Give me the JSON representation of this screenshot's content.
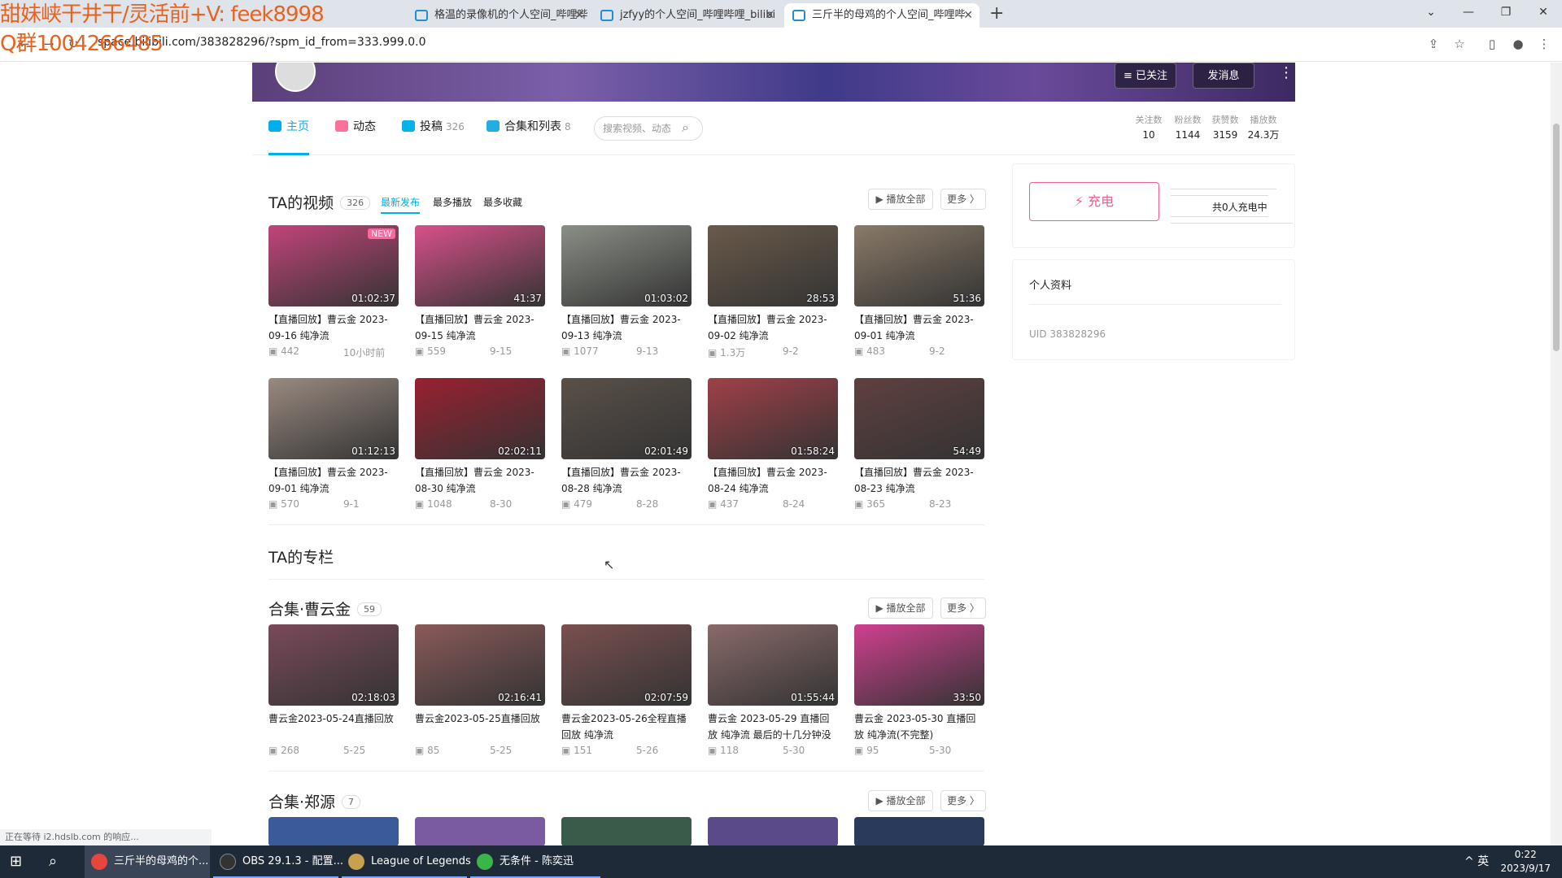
{
  "watermark": {
    "line1": "甜妹峡干井干/灵活前+V: feek8998",
    "line2": "Q群1004266485"
  },
  "browser": {
    "tabs": [
      {
        "label": "格温的录像机的个人空间_哔哩哔"
      },
      {
        "label": "jzfyy的个人空间_哔哩哔哩_bilibi"
      },
      {
        "label": "三斤半的母鸡的个人空间_哔哩哔"
      }
    ],
    "new_tab": "+",
    "url": "space.bilibili.com/383828296/?spm_id_from=333.999.0.0"
  },
  "banner": {
    "follow_label": "≡ 已关注",
    "message_label": "发消息",
    "more": "⋮"
  },
  "nav": {
    "items": [
      {
        "label": "主页",
        "count": "",
        "color": "#00aeec"
      },
      {
        "label": "动态",
        "count": "",
        "color": "#fb7299"
      },
      {
        "label": "投稿",
        "count": "326",
        "color": "#00b5e5"
      },
      {
        "label": "合集和列表",
        "count": "8",
        "color": "#23ade5"
      }
    ],
    "search_placeholder": "搜索视频、动态",
    "stats": [
      {
        "label": "关注数",
        "value": "10"
      },
      {
        "label": "粉丝数",
        "value": "1144"
      },
      {
        "label": "获赞数",
        "value": "3159"
      },
      {
        "label": "播放数",
        "value": "24.3万"
      }
    ]
  },
  "videos": {
    "title": "TA的视频",
    "count": "326",
    "sorts": [
      "最新发布",
      "最多播放",
      "最多收藏"
    ],
    "play_all": "▶ 播放全部",
    "more": "更多 〉",
    "items": [
      {
        "title": "【直播回放】曹云金 2023-09-16 纯净流",
        "duration": "01:02:37",
        "plays": "442",
        "date": "10小时前",
        "new": "NEW",
        "color": "#c2447a"
      },
      {
        "title": "【直播回放】曹云金 2023-09-15 纯净流",
        "duration": "41:37",
        "plays": "559",
        "date": "9-15",
        "color": "#d8508a"
      },
      {
        "title": "【直播回放】曹云金 2023-09-13 纯净流",
        "duration": "01:03:02",
        "plays": "1077",
        "date": "9-13",
        "color": "#8a8f86"
      },
      {
        "title": "【直播回放】曹云金 2023-09-02 纯净流",
        "duration": "28:53",
        "plays": "1.3万",
        "date": "9-2",
        "color": "#6a5a4a"
      },
      {
        "title": "【直播回放】曹云金 2023-09-01 纯净流",
        "duration": "51:36",
        "plays": "483",
        "date": "9-2",
        "color": "#8a7a68"
      },
      {
        "title": "【直播回放】曹云金 2023-09-01 纯净流",
        "duration": "01:12:13",
        "plays": "570",
        "date": "9-1",
        "color": "#9a8a80"
      },
      {
        "title": "【直播回放】曹云金 2023-08-30 纯净流",
        "duration": "02:02:11",
        "plays": "1048",
        "date": "8-30",
        "color": "#9a2030"
      },
      {
        "title": "【直播回放】曹云金 2023-08-28 纯净流",
        "duration": "02:01:49",
        "plays": "479",
        "date": "8-28",
        "color": "#5a5048"
      },
      {
        "title": "【直播回放】曹云金 2023-08-24 纯净流",
        "duration": "01:58:24",
        "plays": "437",
        "date": "8-24",
        "color": "#a04048"
      },
      {
        "title": "【直播回放】曹云金 2023-08-23 纯净流",
        "duration": "54:49",
        "plays": "365",
        "date": "8-23",
        "color": "#604040"
      }
    ]
  },
  "column": {
    "title": "TA的专栏"
  },
  "collection1": {
    "title": "合集·曹云金",
    "count": "59",
    "play_all": "▶ 播放全部",
    "more": "更多 〉",
    "items": [
      {
        "title": "曹云金2023-05-24直播回放",
        "duration": "02:18:03",
        "plays": "268",
        "date": "5-25",
        "color": "#7a4a5a"
      },
      {
        "title": "曹云金2023-05-25直播回放",
        "duration": "02:16:41",
        "plays": "85",
        "date": "5-25",
        "color": "#8a5a5a"
      },
      {
        "title": "曹云金2023-05-26全程直播回放 纯净流",
        "duration": "02:07:59",
        "plays": "151",
        "date": "5-26",
        "color": "#7a5050"
      },
      {
        "title": "曹云金 2023-05-29 直播回放 纯净流 最后的十几分钟没录好",
        "duration": "01:55:44",
        "plays": "118",
        "date": "5-30",
        "color": "#8a6a6a"
      },
      {
        "title": "曹云金 2023-05-30 直播回放 纯净流(不完整)",
        "duration": "33:50",
        "plays": "95",
        "date": "5-30",
        "color": "#d04090"
      }
    ]
  },
  "collection2": {
    "title": "合集·郑源",
    "count": "7",
    "play_all": "▶ 播放全部",
    "more": "更多 〉"
  },
  "sidebar": {
    "charge_label": "⚡ 充电",
    "charge_count": "共0人充电中",
    "profile_label": "个人资料",
    "uid": "UID  383828296"
  },
  "status_text": "正在等待 i2.hdslb.com 的响应...",
  "taskbar": {
    "items": [
      {
        "label": "三斤半的母鸡的个...",
        "color": "#e8453c"
      },
      {
        "label": "OBS 29.1.3 - 配置...",
        "color": "#333"
      },
      {
        "label": "League of Legends",
        "color": "#c8a050"
      },
      {
        "label": "无条件 - 陈奕迅",
        "color": "#3ab54a"
      }
    ],
    "tray": "^ 英",
    "time": "0:22",
    "date": "2023/9/17"
  }
}
